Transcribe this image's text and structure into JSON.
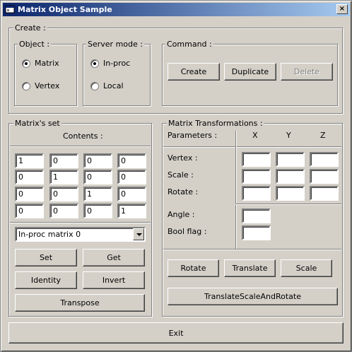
{
  "window": {
    "title": "Matrix Object Sample",
    "close_label": "×"
  },
  "create": {
    "legend": "Create :",
    "object": {
      "legend": "Object :",
      "options": [
        "Matrix",
        "Vertex"
      ],
      "selected": "Matrix"
    },
    "server_mode": {
      "legend": "Server mode :",
      "options": [
        "In-proc",
        "Local"
      ],
      "selected": "In-proc"
    },
    "command": {
      "legend": "Command :",
      "create": "Create",
      "duplicate": "Duplicate",
      "delete": "Delete"
    }
  },
  "matrix_set": {
    "legend": "Matrix's set",
    "contents_label": "Contents :",
    "cells": [
      [
        "1",
        "0",
        "0",
        "0"
      ],
      [
        "0",
        "1",
        "0",
        "0"
      ],
      [
        "0",
        "0",
        "1",
        "0"
      ],
      [
        "0",
        "0",
        "0",
        "1"
      ]
    ],
    "selected_matrix": "In-proc matrix 0",
    "buttons": {
      "set": "Set",
      "get": "Get",
      "identity": "Identity",
      "invert": "Invert",
      "transpose": "Transpose"
    }
  },
  "transforms": {
    "legend": "Matrix Transformations :",
    "parameters_label": "Parameters :",
    "x_label": "X",
    "y_label": "Y",
    "z_label": "Z",
    "vertex_label": "Vertex :",
    "scale_label": "Scale :",
    "rotate_label": "Rotate :",
    "angle_label": "Angle :",
    "bool_label": "Bool flag :",
    "vertex": [
      "",
      "",
      ""
    ],
    "scale": [
      "",
      "",
      ""
    ],
    "rotate": [
      "",
      "",
      ""
    ],
    "angle": "",
    "bool_flag": "",
    "buttons": {
      "rotate": "Rotate",
      "translate": "Translate",
      "scale": "Scale",
      "tsr": "TranslateScaleAndRotate"
    }
  },
  "exit_label": "Exit"
}
